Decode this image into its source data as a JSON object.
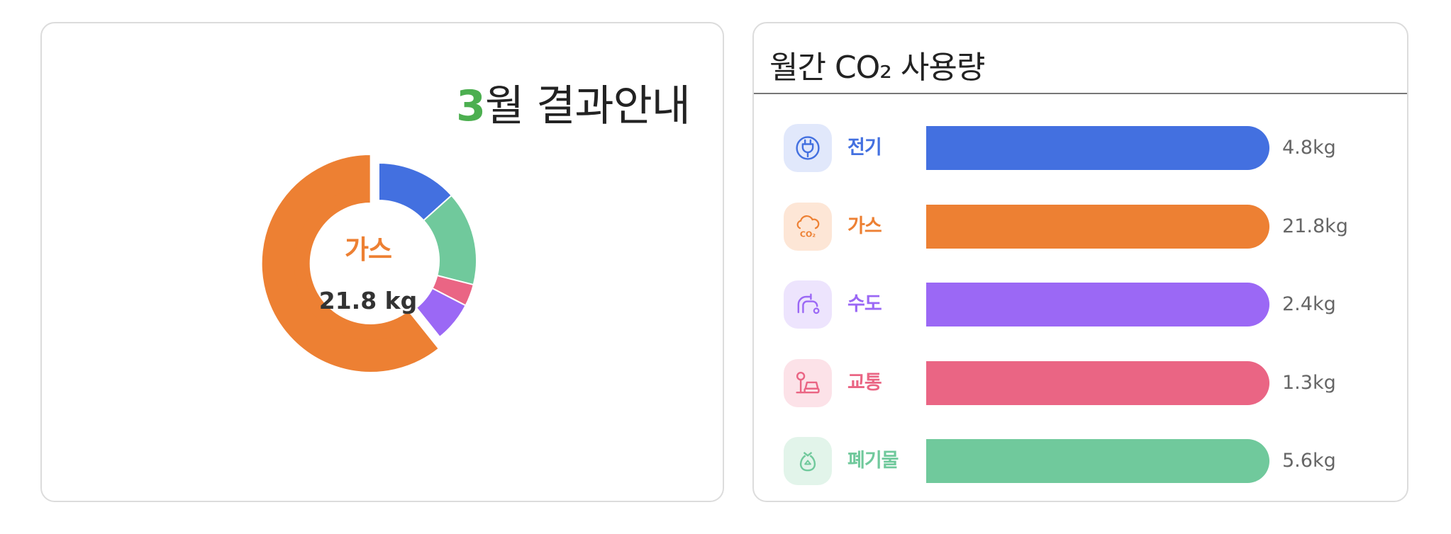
{
  "left_card": {
    "month_number": "3",
    "title_suffix": "월 결과안내",
    "center_label": "가스",
    "center_value": "21.8 kg"
  },
  "right_card": {
    "title": "월간 CO₂ 사용량"
  },
  "categories": [
    {
      "label": "전기",
      "value_text": "4.8kg",
      "icon": "plug-icon",
      "color": "#4370e0",
      "icon_bg": "#e1e8fb"
    },
    {
      "label": "가스",
      "value_text": "21.8kg",
      "icon": "co2-cloud-icon",
      "color": "#ed8033",
      "icon_bg": "#fde6d6"
    },
    {
      "label": "수도",
      "value_text": "2.4kg",
      "icon": "faucet-icon",
      "color": "#9b68f5",
      "icon_bg": "#ede4fd"
    },
    {
      "label": "교통",
      "value_text": "1.3kg",
      "icon": "car-sign-icon",
      "color": "#ea6584",
      "icon_bg": "#fce2e8"
    },
    {
      "label": "폐기물",
      "value_text": "5.6kg",
      "icon": "waste-bag-icon",
      "color": "#70c99c",
      "icon_bg": "#e2f4ea"
    }
  ],
  "chart_data": [
    {
      "type": "pie",
      "categories": [
        "전기",
        "폐기물",
        "교통",
        "수도",
        "가스"
      ],
      "values": [
        4.8,
        5.6,
        1.3,
        2.4,
        21.8
      ],
      "colors": [
        "#4370e0",
        "#70c99c",
        "#ea6584",
        "#9b68f5",
        "#ed8033"
      ],
      "highlighted": "가스",
      "title": "",
      "legend": "none"
    },
    {
      "type": "bar",
      "orientation": "horizontal",
      "categories": [
        "전기",
        "가스",
        "수도",
        "교통",
        "폐기물"
      ],
      "values": [
        4.8,
        21.8,
        2.4,
        1.3,
        5.6
      ],
      "value_labels": [
        "4.8kg",
        "21.8kg",
        "2.4kg",
        "1.3kg",
        "5.6kg"
      ],
      "bar_fill_fraction": [
        1,
        1,
        1,
        1,
        1
      ],
      "title": "월간 CO₂ 사용량",
      "xlabel": "",
      "ylabel": "",
      "grid": false
    }
  ]
}
